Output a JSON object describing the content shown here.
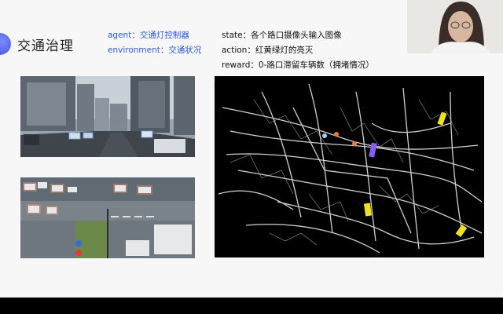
{
  "slide": {
    "title": "交通治理",
    "agent_line": "agent：交通灯控制器",
    "environment_line": "environment：交通状况",
    "state_line": "state：各个路口摄像头输入图像",
    "action_line": "action：红黄绿灯的亮灭",
    "reward_line": "reward：0-路口滞留车辆数（拥堵情况）"
  },
  "images": {
    "street_camera": "street-camera-photo",
    "intersection_camera": "intersection-camera-photo",
    "city_map": "city-traffic-map"
  },
  "colors": {
    "accent_blue": "#2d5bd7",
    "map_bg": "#000000",
    "marker_yellow": "#f0e020",
    "marker_purple": "#8a5cf0",
    "marker_orange": "#f07a30"
  }
}
